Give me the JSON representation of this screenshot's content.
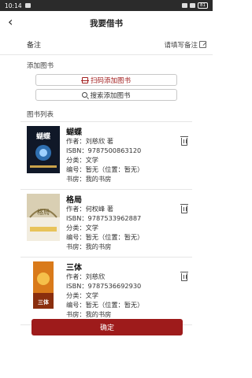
{
  "status": {
    "time": "10:14",
    "battery": "81"
  },
  "nav": {
    "back_glyph": "‹",
    "title": "我要借书"
  },
  "remark": {
    "label": "备注",
    "placeholder": "请填写备注"
  },
  "add_section": {
    "title": "添加图书",
    "scan_label": "扫码添加图书",
    "search_label": "搜索添加图书"
  },
  "list": {
    "title": "图书列表",
    "books": [
      {
        "title": "蝴蝶",
        "author": "作者：刘慈欣 著",
        "isbn": "ISBN：9787500863120",
        "category": "分类：文学",
        "code": "编号：暂无（位置：暂无）",
        "room": "书房：我的书房",
        "cover_text": "蝴蝶"
      },
      {
        "title": "格局",
        "author": "作者：何权峰 著",
        "isbn": "ISBN：9787533962887",
        "category": "分类：文学",
        "code": "编号：暂无（位置：暂无）",
        "room": "书房：我的书房",
        "cover_text": "格局"
      },
      {
        "title": "三体",
        "author": "作者：刘慈欣",
        "isbn": "ISBN：9787536692930",
        "category": "分类：文学",
        "code": "编号：暂无（位置：暂无）",
        "room": "书房：我的书房",
        "cover_text": "三体"
      }
    ]
  },
  "confirm_label": "确定",
  "colors": {
    "accent": "#9e1b1b",
    "scan_text": "#a32020"
  }
}
